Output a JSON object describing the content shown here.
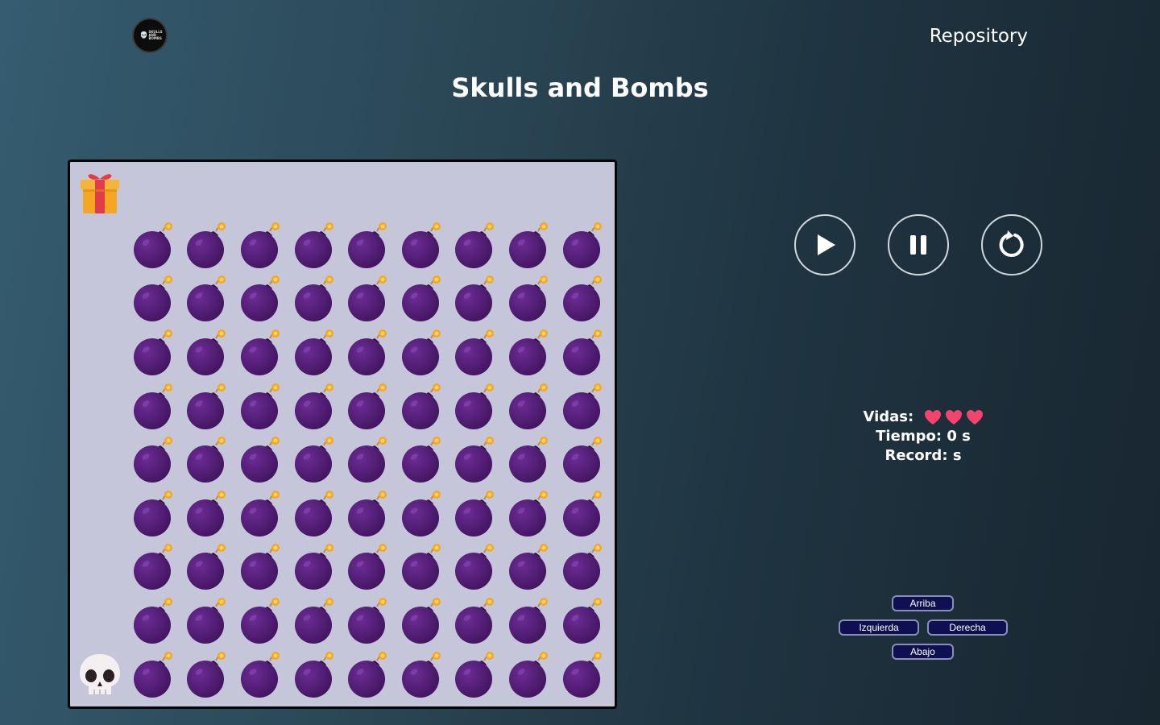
{
  "header": {
    "logo_text": "SKULLS\nAND\nBOMBS",
    "repo_link": "Repository"
  },
  "page_title": "Skulls and Bombs",
  "board": {
    "rows": 10,
    "cols": 10,
    "layout": [
      "G_________",
      "_XXXXXXXXX",
      "_XXXXXXXXX",
      "_XXXXXXXXX",
      "_XXXXXXXXX",
      "_XXXXXXXXX",
      "_XXXXXXXXX",
      "_XXXXXXXXX",
      "_XXXXXXXXX",
      "PXXXXXXXXX"
    ],
    "legend": {
      "G": "gift",
      "X": "bomb",
      "P": "skull-player",
      "_": "empty"
    }
  },
  "controls": {
    "start": "play-icon",
    "pause": "pause-icon",
    "restart": "restart-icon"
  },
  "stats": {
    "lives_label": "Vidas:",
    "lives": 3,
    "time_label": "Tiempo:",
    "time_value": "0",
    "time_unit": "s",
    "record_label": "Record:",
    "record_value": "",
    "record_unit": "s"
  },
  "movement": {
    "up": "Arriba",
    "left": "Izquierda",
    "right": "Derecha",
    "down": "Abajo"
  },
  "colors": {
    "board_bg": "#c6c6da",
    "bomb": "#4b1a6e",
    "heart": "#f4436c",
    "move_button_bg": "#0e1051"
  }
}
